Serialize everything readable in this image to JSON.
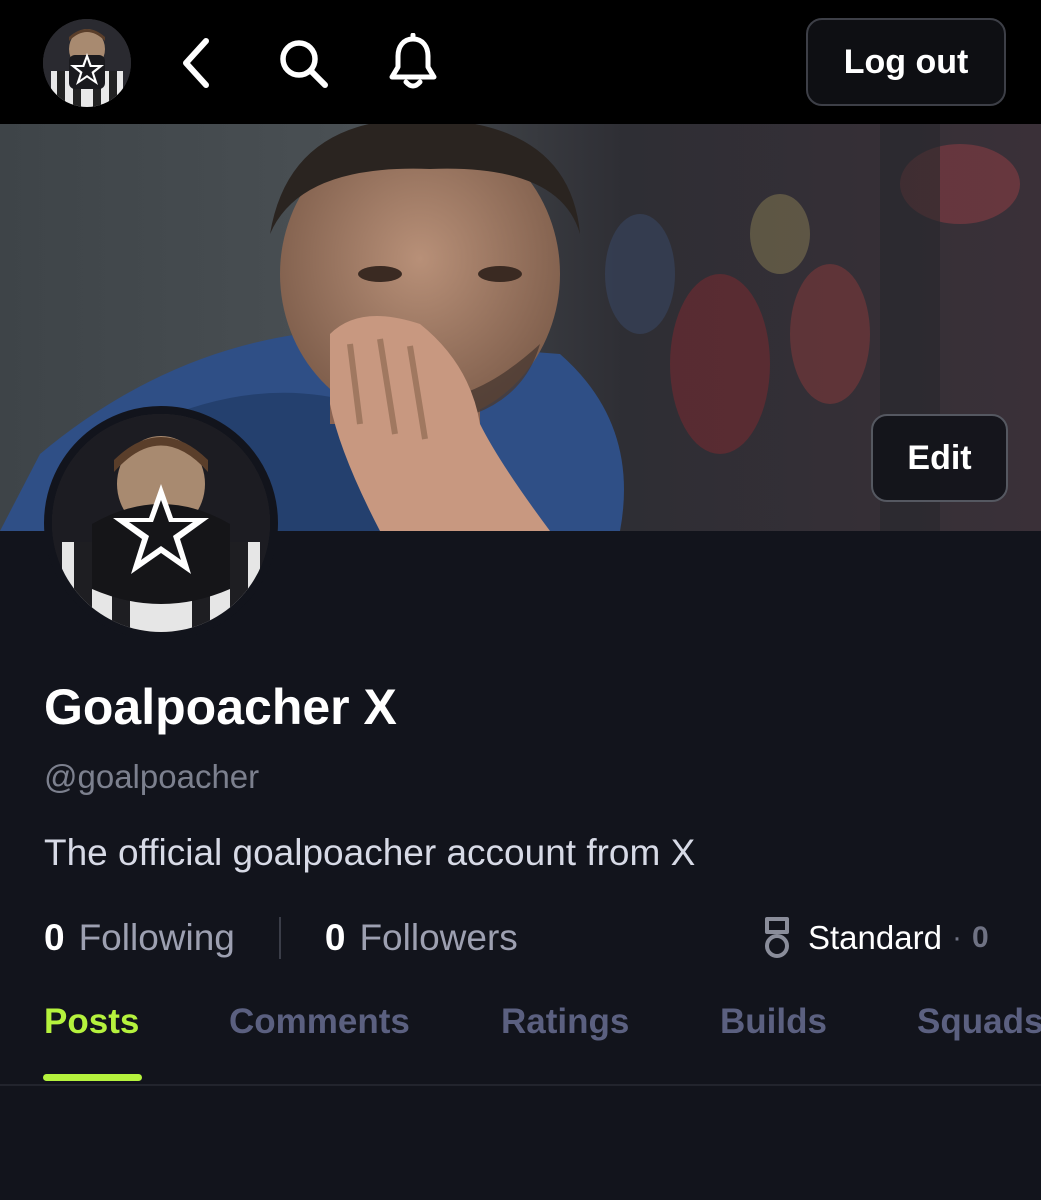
{
  "header": {
    "logout_label": "Log out"
  },
  "banner": {
    "edit_label": "Edit"
  },
  "profile": {
    "display_name": "Goalpoacher X",
    "handle": "@goalpoacher",
    "bio": "The official goalpoacher account from X",
    "following_count": "0",
    "following_label": "Following",
    "followers_count": "0",
    "followers_label": "Followers",
    "rank_label": "Standard",
    "rank_separator": "·",
    "rank_count": "0"
  },
  "tabs": [
    {
      "label": "Posts",
      "active": true
    },
    {
      "label": "Comments",
      "active": false
    },
    {
      "label": "Ratings",
      "active": false
    },
    {
      "label": "Builds",
      "active": false
    },
    {
      "label": "Squads",
      "active": false
    }
  ],
  "colors": {
    "background": "#12141c",
    "topbar": "#000000",
    "accent": "#b5f23d",
    "tab_inactive": "#5b6080",
    "muted_text": "#9da0b1"
  },
  "icons": [
    "back-icon",
    "search-icon",
    "bell-icon",
    "medal-icon",
    "star-icon"
  ]
}
